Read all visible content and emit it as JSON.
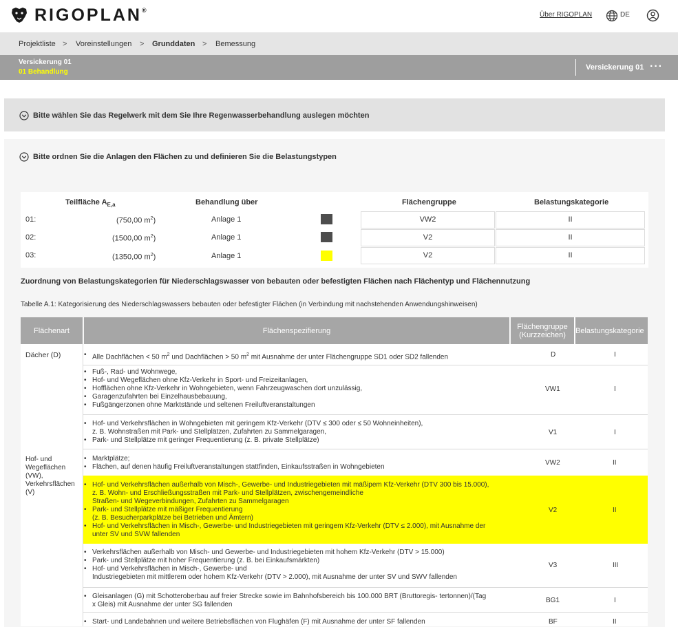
{
  "header": {
    "brand": "RIGOPLAN",
    "brand_reg": "®",
    "about_link": "Über RIGOPLAN",
    "language": "DE"
  },
  "breadcrumb": [
    "Projektliste",
    "Voreinstellungen",
    "Grunddaten",
    "Bemessung"
  ],
  "breadcrumb_sep": ">",
  "titlebar": {
    "title": "Versickerung 01",
    "subtitle": "01 Behandlung",
    "right_label": "Versickerung 01",
    "more": "···",
    "subtitle_color": "#ffff00"
  },
  "section1": {
    "title": "Bitte wählen Sie das Regelwerk mit dem Sie Ihre Regenwasserbehandlung auslegen möchten"
  },
  "section2": {
    "title": "Bitte ordnen Sie die Anlagen den Flächen zu und definieren Sie die Belastungstypen"
  },
  "assignment": {
    "headers": {
      "teilflaeche": "Teilfläche A",
      "teilflaeche_sub": "E,a",
      "behandlung": "Behandlung über",
      "flaechengruppe": "Flächengruppe",
      "belastung": "Belastungskategorie"
    },
    "rows": [
      {
        "num": "01:",
        "area": "(750,00 m",
        "area_sup": "2",
        "area_end": ")",
        "anlage": "Anlage 1",
        "swatch": "#4d4d4d",
        "gruppe": "VW2",
        "kategorie": "II"
      },
      {
        "num": "02:",
        "area": "(1500,00 m",
        "area_sup": "2",
        "area_end": ")",
        "anlage": "Anlage 1",
        "swatch": "#4d4d4d",
        "gruppe": "V2",
        "kategorie": "II"
      },
      {
        "num": "03:",
        "area": "(1350,00 m",
        "area_sup": "2",
        "area_end": ")",
        "anlage": "Anlage 1",
        "swatch": "#ffff00",
        "gruppe": "V2",
        "kategorie": "II"
      }
    ]
  },
  "zuordnung_heading": "Zuordnung von Belastungskategorien für Niederschlagswasser von bebauten oder befestigten Flächen nach Flächentyp und Flächennutzung",
  "table_caption": "Tabelle A.1: Kategorisierung des Niederschlagswassers bebauten oder befestigter Flächen (in Verbindung mit nachstehenden Anwendungshinweisen)",
  "category_table": {
    "headers": {
      "flaechenart": "Flächenart",
      "spezifizierung": "Flächenspezifierung",
      "gruppe_line1": "Flächengruppe",
      "gruppe_line2": "(Kurzzeichen)",
      "kategorie": "Belastungskategorie"
    },
    "highlight_color": "#ffff00",
    "group_labels": {
      "daecher": "Dächer (D)",
      "hof": "Hof- und Wegeflächen (VW), Verkehrsflächen (V)"
    },
    "rows": [
      {
        "lines": [
          {
            "t": "Alle Dachflächen < 50 m² und Dachflächen > 50 m² mit Ausnahme der unter Flächengruppe SD1 oder SD2 fallenden",
            "b": true
          }
        ],
        "gruppe": "D",
        "kategorie": "I"
      },
      {
        "lines": [
          {
            "t": "Fuß-, Rad- und Wohnwege,",
            "b": true
          },
          {
            "t": "Hof- und Wegeflächen ohne Kfz-Verkehr in Sport- und Freizeitanlagen,",
            "b": false
          },
          {
            "t": "Hofflächen ohne Kfz-Verkehr in Wohngebieten, wenn Fahrzeugwaschen dort unzulässig,",
            "b": false
          },
          {
            "t": "Garagenzufahrten bei Einzelhausbebauung,",
            "b": false
          },
          {
            "t": "Fußgängerzonen ohne Marktstände und seltenen Freiluftveranstaltungen",
            "b": false
          }
        ],
        "gruppe": "VW1",
        "kategorie": "I"
      },
      {
        "lines": [
          {
            "t": "Hof- und Verkehrsflächen in Wohngebieten mit geringem Kfz-Verkehr (DTV ≤ 300 oder ≤ 50 Wohneinheiten),",
            "b": true
          },
          {
            "t": "z. B. Wohnstraßen mit Park- und Stellplätzen, Zufahrten zu Sammelgaragen,",
            "b": false
          },
          {
            "t": "Park- und Stellplätze mit geringer Frequentierung (z. B. private Stellplätze)",
            "b": true
          }
        ],
        "gruppe": "V1",
        "kategorie": "I"
      },
      {
        "lines": [
          {
            "t": "Marktplätze;",
            "b": true
          },
          {
            "t": "Flächen, auf denen häufig Freiluftveranstaltungen stattfinden, Einkaufsstraßen in Wohngebieten",
            "b": false
          }
        ],
        "gruppe": "VW2",
        "kategorie": "II"
      },
      {
        "lines": [
          {
            "t": "Hof- und Verkehrsflächen außerhalb von Misch-, Gewerbe- und Industriegebieten mit mäßipem Kfz-Verkehr (DTV 300 bis 15.000),",
            "b": true
          },
          {
            "t": "z. B. Wohn- und Erschließungsstraßen mit Park- und Stellplätzen, zwischengemeindliche",
            "b": false
          },
          {
            "t": "Straßen- und Wegeverbindungen, Zufahrten zu Sammelgaragen",
            "b": false
          },
          {
            "t": "Park- und Stellplätze mit mäßiger Frequentierung",
            "b": true
          },
          {
            "t": "(z. B. Besucherparkplätze bei Betrieben und Ämtern)",
            "b": false
          },
          {
            "t": "Hof- und Verkehrsflächen in Misch-, Gewerbe- und Industriegebieten mit geringem Kfz-Verkehr (DTV ≤ 2.000), mit Ausnahme der",
            "b": true
          },
          {
            "t": "unter SV und SVW fallenden",
            "b": false
          }
        ],
        "gruppe": "V2",
        "kategorie": "II",
        "highlight": true
      },
      {
        "lines": [
          {
            "t": "Verkehrsflächen außerhalb von Misch- und Gewerbe- und Industriegebieten mit hohem Kfz-Verkehr (DTV > 15.000)",
            "b": true
          },
          {
            "t": "Park- und Stellplätze mit hoher Frequentierung (z. B. bei Einkaufsmärkten)",
            "b": true
          },
          {
            "t": "Hof- und Verkehrsflächen in Misch-, Gewerbe- und",
            "b": true
          },
          {
            "t": "Industriegebieten mit mittlerem oder hohem Kfz-Verkehr (DTV > 2.000), mit Ausnahme der unter SV und SWV fallenden",
            "b": false
          }
        ],
        "gruppe": "V3",
        "kategorie": "III"
      },
      {
        "lines": [
          {
            "t": "Gleisanlagen (G) mit Schotteroberbau auf freier Strecke sowie im Bahnhofsbereich bis 100.000 BRT (Bruttoregis- tertonnen)/(Tag",
            "b": true
          },
          {
            "t": "x Gleis) mit Ausnahme der unter SG fallenden",
            "b": false
          }
        ],
        "gruppe": "BG1",
        "kategorie": "I"
      },
      {
        "lines": [
          {
            "t": "Start- und Landebahnen und weitere Betriebsflächen von Flughäfen (F) mit Ausnahme der unter SF fallenden",
            "b": true
          }
        ],
        "gruppe": "BF",
        "kategorie": "II"
      }
    ]
  }
}
